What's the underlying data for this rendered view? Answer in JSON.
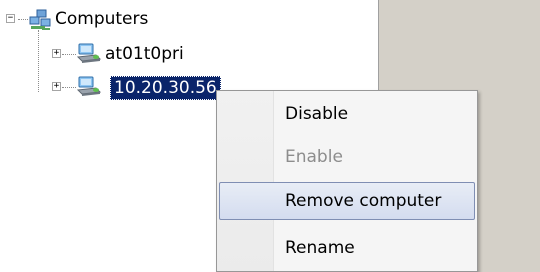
{
  "tree": {
    "root": {
      "label": "Computers",
      "icon": "network-computers-icon",
      "expander": "−"
    },
    "children": [
      {
        "label": "at01t0pri",
        "icon": "computer-icon",
        "expander": "+",
        "selected": false
      },
      {
        "label": "10.20.30.56",
        "icon": "computer-icon",
        "expander": "+",
        "selected": true
      }
    ]
  },
  "context_menu": {
    "items": [
      {
        "label": "Disable",
        "enabled": true,
        "highlighted": false
      },
      {
        "label": "Enable",
        "enabled": false,
        "highlighted": false
      },
      {
        "label": "Remove computer",
        "enabled": true,
        "highlighted": true
      },
      {
        "label": "Rename",
        "enabled": true,
        "highlighted": false
      }
    ]
  },
  "colors": {
    "selection": "#0a246a",
    "menu_highlight_border": "#7f8eb3",
    "disabled_text": "#8d8d8d",
    "pane_bg": "#d4d0c8"
  }
}
